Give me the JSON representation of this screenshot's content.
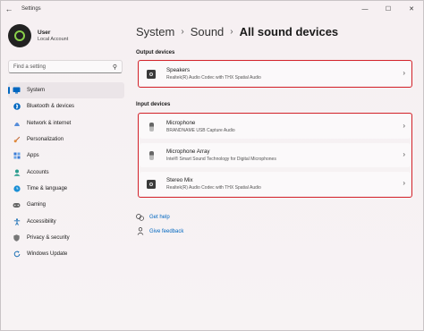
{
  "window": {
    "title": "Settings",
    "back": "←",
    "minimize": "—",
    "maximize": "☐",
    "close": "✕"
  },
  "profile": {
    "name": "User",
    "account": "Local Account"
  },
  "search": {
    "placeholder": "Find a setting"
  },
  "nav": [
    {
      "label": "System",
      "icon": "monitor-icon",
      "color": "#0067c0",
      "active": true
    },
    {
      "label": "Bluetooth & devices",
      "icon": "bluetooth-icon",
      "color": "#0067c0"
    },
    {
      "label": "Network & internet",
      "icon": "network-icon",
      "color": "#3a7bd5"
    },
    {
      "label": "Personalization",
      "icon": "brush-icon",
      "color": "#c0622d"
    },
    {
      "label": "Apps",
      "icon": "apps-icon",
      "color": "#3a7bd5"
    },
    {
      "label": "Accounts",
      "icon": "accounts-icon",
      "color": "#2a9d8f"
    },
    {
      "label": "Time & language",
      "icon": "globe-clock-icon",
      "color": "#1a8fd5"
    },
    {
      "label": "Gaming",
      "icon": "gamepad-icon",
      "color": "#666666"
    },
    {
      "label": "Accessibility",
      "icon": "accessibility-icon",
      "color": "#1a6fb5"
    },
    {
      "label": "Privacy & security",
      "icon": "shield-icon",
      "color": "#777777"
    },
    {
      "label": "Windows Update",
      "icon": "update-icon",
      "color": "#1a6fb5"
    }
  ],
  "breadcrumb": {
    "level1": "System",
    "level2": "Sound",
    "current": "All sound devices",
    "sep": "›"
  },
  "output": {
    "title": "Output devices",
    "devices": [
      {
        "name": "Speakers",
        "desc": "Realtek(R) Audio Codec with THX Spatial Audio",
        "icon": "speaker-icon"
      }
    ]
  },
  "input": {
    "title": "Input devices",
    "devices": [
      {
        "name": "Microphone",
        "desc": "BRANDNAME USB Capture Audio",
        "icon": "microphone-icon"
      },
      {
        "name": "Microphone Array",
        "desc": "Intel® Smart Sound Technology for Digital Microphones",
        "icon": "microphone-icon"
      },
      {
        "name": "Stereo Mix",
        "desc": "Realtek(R) Audio Codec with THX Spatial Audio",
        "icon": "speaker-icon"
      }
    ]
  },
  "links": {
    "help": "Get help",
    "feedback": "Give feedback"
  },
  "colors": {
    "accent": "#0067c0",
    "highlight": "#d4232a"
  }
}
